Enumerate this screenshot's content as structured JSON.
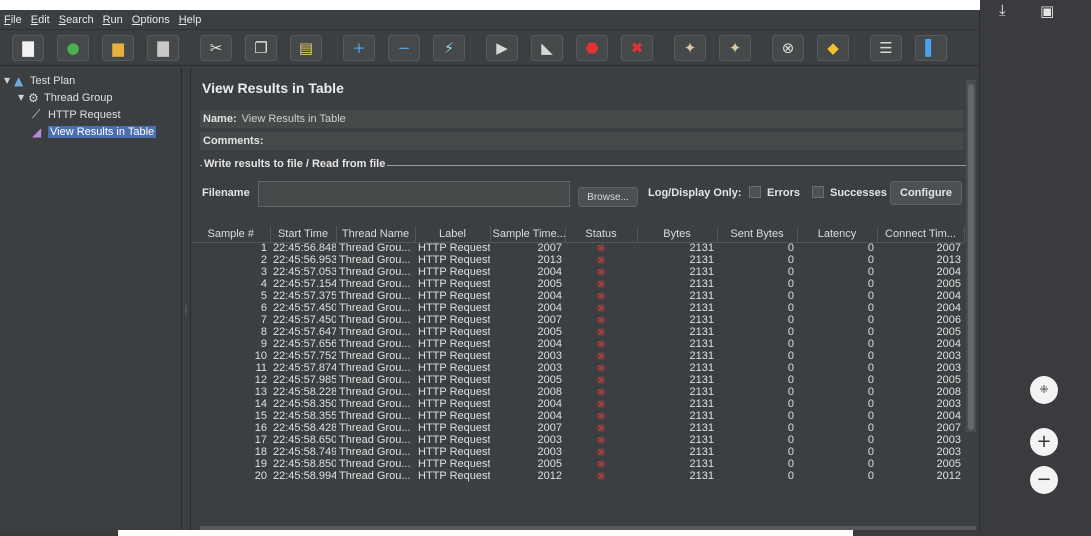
{
  "menu": [
    {
      "mnemonic": "F",
      "rest": "ile"
    },
    {
      "mnemonic": "E",
      "rest": "dit"
    },
    {
      "mnemonic": "S",
      "rest": "earch"
    },
    {
      "mnemonic": "R",
      "rest": "un"
    },
    {
      "mnemonic": "O",
      "rest": "ptions"
    },
    {
      "mnemonic": "H",
      "rest": "elp"
    }
  ],
  "toolbar": [
    {
      "name": "new-icon",
      "glyph": "▇",
      "color": "#f2f2f2"
    },
    {
      "name": "templates-icon",
      "glyph": "●",
      "color": "#4caf50"
    },
    {
      "name": "open-icon",
      "glyph": "▆",
      "color": "#e6b23c"
    },
    {
      "name": "save-icon",
      "glyph": "▇",
      "color": "#c8c8c8"
    },
    {
      "name": "cut-icon",
      "glyph": "✂",
      "color": "#e6e6e6"
    },
    {
      "name": "copy-icon",
      "glyph": "❐",
      "color": "#e6e6e6"
    },
    {
      "name": "paste-icon",
      "glyph": "▤",
      "color": "#e6c96a"
    },
    {
      "name": "expand-icon",
      "glyph": "+",
      "color": "#4aa3f0"
    },
    {
      "name": "collapse-icon",
      "glyph": "−",
      "color": "#4aa3f0"
    },
    {
      "name": "toggle-icon",
      "glyph": "⚡",
      "color": "#8fd0e8"
    },
    {
      "name": "start-icon",
      "glyph": "▶",
      "color": "#d8d8d8"
    },
    {
      "name": "start-no-pauses-icon",
      "glyph": "◣",
      "color": "#d8d8d8"
    },
    {
      "name": "stop-icon",
      "glyph": "⬣",
      "color": "#e03434"
    },
    {
      "name": "shutdown-icon",
      "glyph": "✖",
      "color": "#e03434"
    },
    {
      "name": "clear-icon",
      "glyph": "✦",
      "color": "#d9c9a3"
    },
    {
      "name": "clear-all-icon",
      "glyph": "✦",
      "color": "#d9c9a3"
    },
    {
      "name": "search-icon",
      "glyph": "⊗",
      "color": "#dddddd"
    },
    {
      "name": "reset-search-icon",
      "glyph": "◆",
      "color": "#f0c030"
    },
    {
      "name": "function-helper-icon",
      "glyph": "☰",
      "color": "#d8d8d8"
    },
    {
      "name": "help-icon",
      "glyph": "▌",
      "color": "#4aa3f0"
    }
  ],
  "tree": {
    "test_plan": "Test Plan",
    "thread_group": "Thread Group",
    "http_request": "HTTP Request",
    "view_results": "View Results in Table"
  },
  "panel": {
    "title": "View Results in Table",
    "name_label": "Name:",
    "name_value": "View Results in Table",
    "comments_label": "Comments:",
    "fileset_legend": "Write results to file / Read from file",
    "filename_label": "Filename",
    "filename_value": "",
    "browse_label": "Browse...",
    "log_display_label": "Log/Display Only:",
    "errors_label": "Errors",
    "successes_label": "Successes",
    "configure_label": "Configure"
  },
  "table": {
    "columns": [
      "Sample #",
      "Start Time",
      "Thread Name",
      "Label",
      "Sample Time...",
      "Status",
      "Bytes",
      "Sent Bytes",
      "Latency",
      "Connect Tim..."
    ],
    "rows": [
      [
        "1",
        "22:45:56.848",
        "Thread Grou...",
        "HTTP Request",
        "2007",
        "2131",
        "0",
        "0",
        "2007"
      ],
      [
        "2",
        "22:45:56.953",
        "Thread Grou...",
        "HTTP Request",
        "2013",
        "2131",
        "0",
        "0",
        "2013"
      ],
      [
        "3",
        "22:45:57.053",
        "Thread Grou...",
        "HTTP Request",
        "2004",
        "2131",
        "0",
        "0",
        "2004"
      ],
      [
        "4",
        "22:45:57.154",
        "Thread Grou...",
        "HTTP Request",
        "2005",
        "2131",
        "0",
        "0",
        "2005"
      ],
      [
        "5",
        "22:45:57.375",
        "Thread Grou...",
        "HTTP Request",
        "2004",
        "2131",
        "0",
        "0",
        "2004"
      ],
      [
        "6",
        "22:45:57.450",
        "Thread Grou...",
        "HTTP Request",
        "2004",
        "2131",
        "0",
        "0",
        "2004"
      ],
      [
        "7",
        "22:45:57.450",
        "Thread Grou...",
        "HTTP Request",
        "2007",
        "2131",
        "0",
        "0",
        "2006"
      ],
      [
        "8",
        "22:45:57.647",
        "Thread Grou...",
        "HTTP Request",
        "2005",
        "2131",
        "0",
        "0",
        "2005"
      ],
      [
        "9",
        "22:45:57.656",
        "Thread Grou...",
        "HTTP Request",
        "2004",
        "2131",
        "0",
        "0",
        "2004"
      ],
      [
        "10",
        "22:45:57.752",
        "Thread Grou...",
        "HTTP Request",
        "2003",
        "2131",
        "0",
        "0",
        "2003"
      ],
      [
        "11",
        "22:45:57.874",
        "Thread Grou...",
        "HTTP Request",
        "2003",
        "2131",
        "0",
        "0",
        "2003"
      ],
      [
        "12",
        "22:45:57.985",
        "Thread Grou...",
        "HTTP Request",
        "2005",
        "2131",
        "0",
        "0",
        "2005"
      ],
      [
        "13",
        "22:45:58.228",
        "Thread Grou...",
        "HTTP Request",
        "2008",
        "2131",
        "0",
        "0",
        "2008"
      ],
      [
        "14",
        "22:45:58.350",
        "Thread Grou...",
        "HTTP Request",
        "2004",
        "2131",
        "0",
        "0",
        "2003"
      ],
      [
        "15",
        "22:45:58.355",
        "Thread Grou...",
        "HTTP Request",
        "2004",
        "2131",
        "0",
        "0",
        "2004"
      ],
      [
        "16",
        "22:45:58.428",
        "Thread Grou...",
        "HTTP Request",
        "2007",
        "2131",
        "0",
        "0",
        "2007"
      ],
      [
        "17",
        "22:45:58.650",
        "Thread Grou...",
        "HTTP Request",
        "2003",
        "2131",
        "0",
        "0",
        "2003"
      ],
      [
        "18",
        "22:45:58.749",
        "Thread Grou...",
        "HTTP Request",
        "2003",
        "2131",
        "0",
        "0",
        "2003"
      ],
      [
        "19",
        "22:45:58.850",
        "Thread Grou...",
        "HTTP Request",
        "2005",
        "2131",
        "0",
        "0",
        "2005"
      ],
      [
        "20",
        "22:45:58.994",
        "Thread Grou...",
        "HTTP Request",
        "2012",
        "2131",
        "0",
        "0",
        "2012"
      ]
    ],
    "status_icon": "error-status-icon"
  },
  "viewer": {
    "download_icon": "download-icon",
    "print_icon": "print-icon",
    "fit_icon": "fit-page-icon",
    "zoom_in_icon": "zoom-in-icon",
    "zoom_out_icon": "zoom-out-icon"
  },
  "colors": {
    "app_bg": "#3c3f41",
    "selection": "#4b6eaf",
    "error": "#e03434"
  }
}
